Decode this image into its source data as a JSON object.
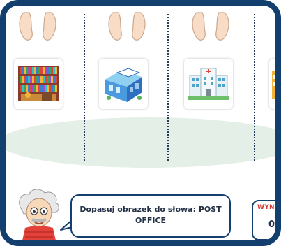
{
  "game": {
    "instruction": "Dopasuj obrazek do słowa: POST OFFICE",
    "score": {
      "label": "WYNIK",
      "value": "0"
    }
  },
  "columns": [
    {
      "image": "library-bookshelves"
    },
    {
      "image": "post-office-building"
    },
    {
      "image": "hospital-building"
    },
    {
      "image": "partial-building"
    }
  ],
  "colors": {
    "frame": "#123f6e",
    "ground": "#e4efe7",
    "feet": "#f8dcc6",
    "score_label": "#d23b34"
  }
}
